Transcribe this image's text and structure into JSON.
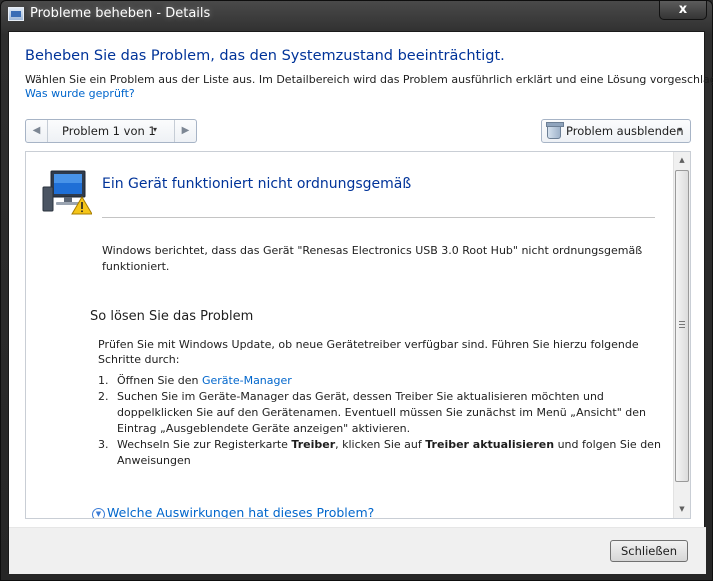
{
  "window": {
    "title": "Probleme beheben - Details",
    "close_glyph": "x"
  },
  "header": {
    "heading": "Beheben Sie das Problem, das den Systemzustand beeinträchtigt.",
    "description": "Wählen Sie ein Problem aus der Liste aus. Im Detailbereich wird das Problem ausführlich erklärt und eine Lösung vorgeschlagen.",
    "checked_link": "Was wurde geprüft?"
  },
  "toolbar": {
    "prev_glyph": "◀",
    "next_glyph": "▶",
    "problem_counter": "Problem 1 von 1",
    "hide_label": "Problem ausblenden",
    "caret": "▾"
  },
  "problem": {
    "icon": "computer-warning-icon",
    "title": "Ein Gerät funktioniert nicht ordnungsgemäß",
    "text": "Windows berichtet, dass das Gerät \"Renesas Electronics USB 3.0 Root Hub\" nicht ordnungsgemäß funktioniert."
  },
  "solution": {
    "title": "So lösen Sie das Problem",
    "intro": "Prüfen Sie mit Windows Update, ob neue Gerätetreiber verfügbar sind. Führen Sie hierzu folgende Schritte durch:",
    "steps": [
      {
        "num": "1.",
        "before": "Öffnen Sie den ",
        "link": "Geräte-Manager",
        "after": ""
      },
      {
        "num": "2.",
        "text": "Suchen Sie im Geräte-Manager das Gerät, dessen Treiber Sie aktualisieren möchten und doppelklicken Sie auf den Gerätenamen. Eventuell müssen Sie zunächst im Menü „Ansicht\" den Eintrag „Ausgeblendete Geräte anzeigen\" aktivieren."
      },
      {
        "num": "3.",
        "before": "Wechseln Sie zur Registerkarte ",
        "bold1": "Treiber",
        "middle": ", klicken Sie auf ",
        "bold2": "Treiber aktualisieren",
        "after": " und folgen Sie den Anweisungen"
      }
    ],
    "more_link": "Welche Auswirkungen hat dieses Problem?",
    "more_glyph": "▼"
  },
  "scrollbar": {
    "up_glyph": "▲",
    "down_glyph": "▼"
  },
  "footer": {
    "close_button": "Schließen"
  },
  "colors": {
    "heading_blue": "#003399",
    "link_blue": "#0066cc",
    "titlebar": "#2e2e2e"
  }
}
